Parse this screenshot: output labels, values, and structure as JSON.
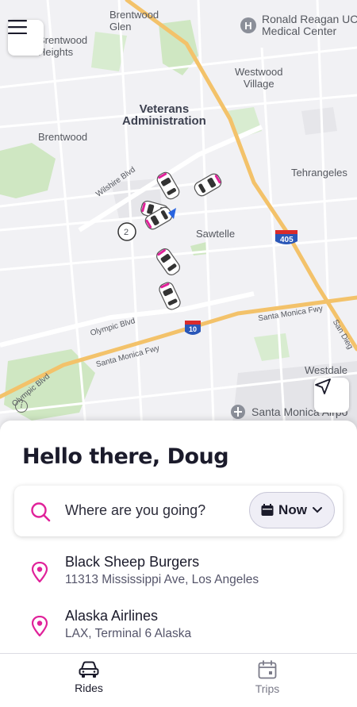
{
  "map": {
    "labels": {
      "brentwood_glen": "Brentwood\nGlen",
      "brentwood_heights": "Brentwood\nHeights",
      "ronald_reagan": "Ronald Reagan UC\nMedical Center",
      "westwood_village": "Westwood\nVillage",
      "veterans_admin": "Veterans\nAdministration",
      "brentwood": "Brentwood",
      "tehrangeles": "Tehrangeles",
      "wilshire": "Wilshire Blvd",
      "sawtelle": "Sawtelle",
      "route_2": "2",
      "i405": "405",
      "santa_monica_fwy_right": "Santa Monica Fwy",
      "olympic_blvd": "Olympic Blvd",
      "i10": "10",
      "santa_monica_fwy_left": "Santa Monica Fwy",
      "san_diego": "San Dieg",
      "westdale": "Westdale",
      "olympic_blvd_left": "Olympic Blvd",
      "santa_monica_airport": "Santa Monica Airpo"
    },
    "icons": {
      "menu": "hamburger-menu-icon",
      "locate": "navigation-arrow-icon",
      "info": "info-icon"
    }
  },
  "sheet": {
    "greeting": "Hello there, Doug",
    "search": {
      "placeholder": "Where are you going?",
      "time_label": "Now"
    },
    "destinations": [
      {
        "name": "Black Sheep Burgers",
        "address": "11313 Mississippi Ave, Los Angeles"
      },
      {
        "name": "Alaska Airlines",
        "address": "LAX, Terminal 6 Alaska"
      }
    ]
  },
  "tabs": [
    {
      "label": "Rides",
      "icon": "car-icon",
      "active": true
    },
    {
      "label": "Trips",
      "icon": "calendar-icon",
      "active": false
    }
  ],
  "colors": {
    "accent": "#e0229a",
    "text": "#1b1b2b",
    "map_bg": "#f1f1f4",
    "park": "#cfe7c2",
    "freeway": "#f3c26a"
  }
}
